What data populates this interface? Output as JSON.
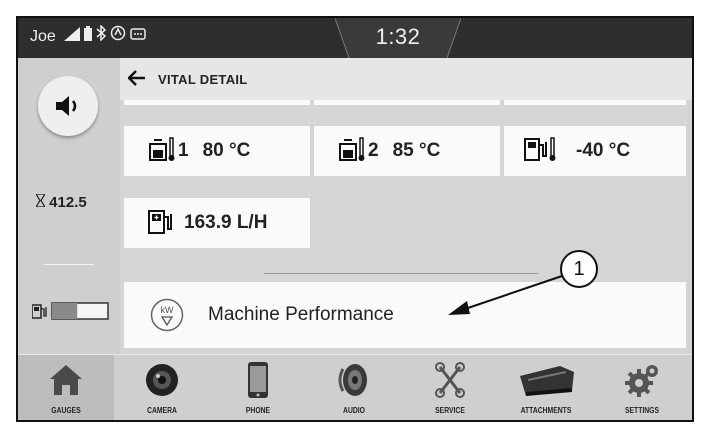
{
  "status_bar": {
    "user": "Joe",
    "time": "1:32",
    "icons": [
      "signal-icon",
      "battery-icon",
      "bluetooth-icon",
      "gps-icon",
      "message-icon"
    ]
  },
  "left_panel": {
    "sound_button": "speaker-icon",
    "hours_value": "412.5",
    "hours_icon": "hourglass-icon",
    "fuel_icon": "fuel-pump-icon",
    "fuel_level": 0.45
  },
  "header": {
    "title": "VITAL DETAIL",
    "back_icon": "back-arrow-icon"
  },
  "tiles": [
    {
      "icon": "coolant-temp-icon",
      "index": "1",
      "value": "80 °C"
    },
    {
      "icon": "coolant-temp-icon",
      "index": "2",
      "value": "85 °C"
    },
    {
      "icon": "fuel-temp-icon",
      "index": "",
      "value": "-40 °C"
    },
    {
      "icon": "fuel-rate-icon",
      "index": "",
      "value": "163.9 L/H"
    }
  ],
  "performance": {
    "label": "Machine Performance",
    "icon": "kw-icon",
    "icon_text": "kW"
  },
  "callout": {
    "number": "1"
  },
  "bottom_nav": [
    {
      "label": "GAUGES",
      "icon": "home-icon",
      "active": true
    },
    {
      "label": "CAMERA",
      "icon": "camera-icon",
      "active": false
    },
    {
      "label": "PHONE",
      "icon": "phone-icon",
      "active": false
    },
    {
      "label": "AUDIO",
      "icon": "audio-speaker-icon",
      "active": false
    },
    {
      "label": "SERVICE",
      "icon": "wrench-icon",
      "active": false
    },
    {
      "label": "ATTACHMENTS",
      "icon": "bucket-icon",
      "active": false
    },
    {
      "label": "SETTINGS",
      "icon": "gear-icon",
      "active": false
    }
  ]
}
